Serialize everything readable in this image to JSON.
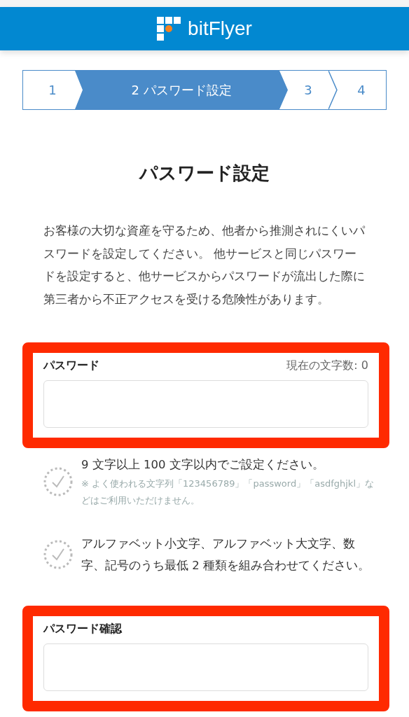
{
  "header": {
    "brand": "bitFlyer"
  },
  "steps": [
    {
      "label": "1",
      "selected": false
    },
    {
      "label": "2 パスワード設定",
      "selected": true
    },
    {
      "label": "3",
      "selected": false
    },
    {
      "label": "4",
      "selected": false
    }
  ],
  "title": "パスワード設定",
  "description": "お客様の大切な資産を守るため、他者から推測されにくいパスワードを設定してください。 他サービスと同じパスワードを設定すると、他サービスからパスワードが流出した際に第三者から不正アクセスを受ける危険性があります。",
  "password_field": {
    "label": "パスワード",
    "counter": "現在の文字数: 0",
    "highlighted": true
  },
  "requirements": [
    {
      "text": "9 文字以上 100 文字以内でご設定ください。",
      "note": "※ よく使われる文字列「123456789」「password」「asdfghjkl」などはご利用いただけません。",
      "met": false
    },
    {
      "text": "アルファベット小文字、アルファベット大文字、数字、記号のうち最低 2 種類を組み合わせてください。",
      "met": false
    }
  ],
  "confirm_field": {
    "label": "パスワード確認",
    "highlighted": true
  }
}
